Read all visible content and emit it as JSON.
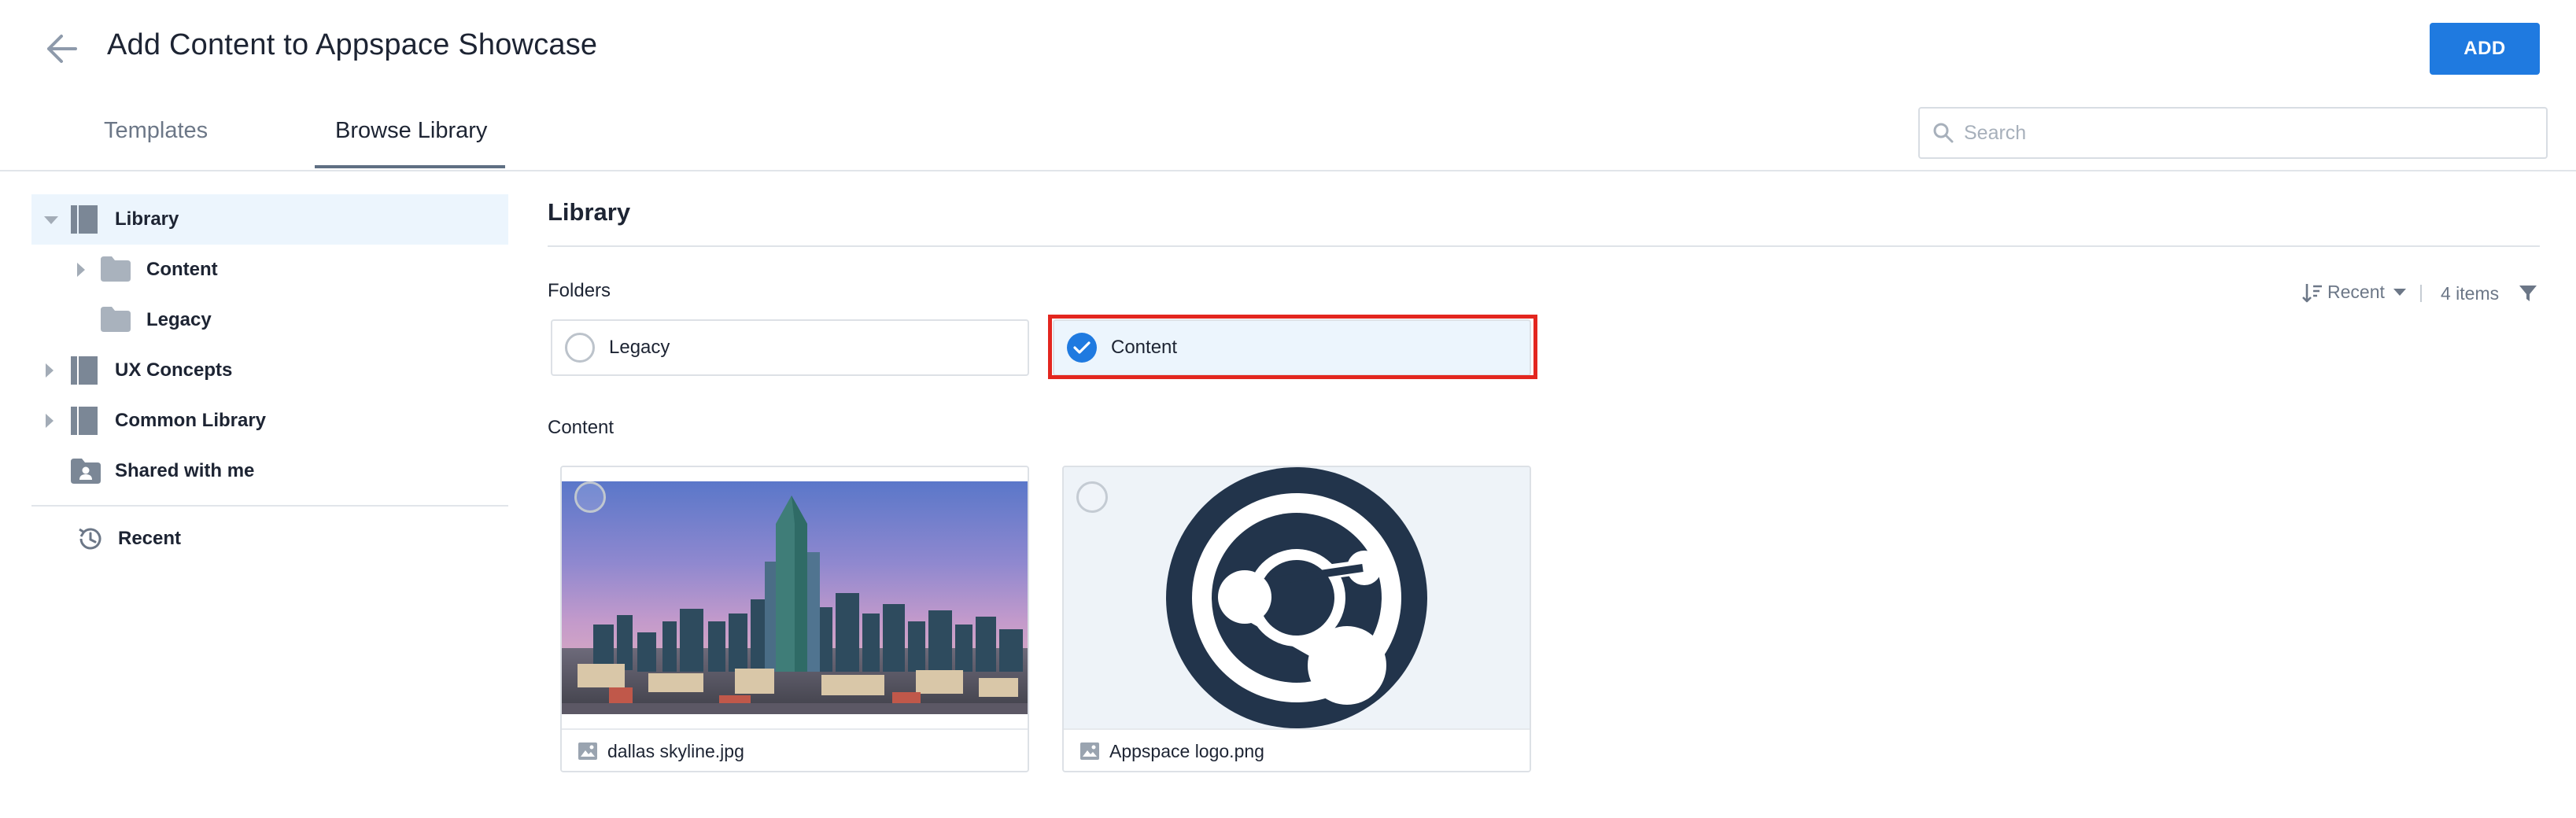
{
  "header": {
    "title": "Add Content to Appspace Showcase",
    "add_label": "ADD",
    "tabs": [
      {
        "label": "Templates",
        "active": false
      },
      {
        "label": "Browse Library",
        "active": true
      }
    ],
    "search": {
      "placeholder": "Search",
      "value": ""
    }
  },
  "sidebar": {
    "items": [
      {
        "label": "Library",
        "icon": "library-book-icon",
        "expanded": true,
        "selected": true
      },
      {
        "label": "Content",
        "icon": "folder-icon",
        "expanded": false
      },
      {
        "label": "Legacy",
        "icon": "folder-icon"
      },
      {
        "label": "UX Concepts",
        "icon": "library-book-icon",
        "expanded": false
      },
      {
        "label": "Common Library",
        "icon": "library-book-icon",
        "expanded": false
      },
      {
        "label": "Shared with me",
        "icon": "shared-folder-icon"
      }
    ],
    "recent": {
      "label": "Recent",
      "icon": "history-icon"
    }
  },
  "main": {
    "title": "Library",
    "folders_label": "Folders",
    "sort_label": "Recent",
    "item_count": "4 items",
    "folders": [
      {
        "name": "Legacy",
        "selected": false
      },
      {
        "name": "Content",
        "selected": true
      }
    ],
    "content_label": "Content",
    "files": [
      {
        "name": "dallas skyline.jpg",
        "type": "image"
      },
      {
        "name": "Appspace logo.png",
        "type": "image"
      }
    ]
  },
  "colors": {
    "accent": "#1f7ae0",
    "selected_bg": "#ecf5fd",
    "highlight": "#e3261f",
    "logo_dark": "#22344b"
  }
}
